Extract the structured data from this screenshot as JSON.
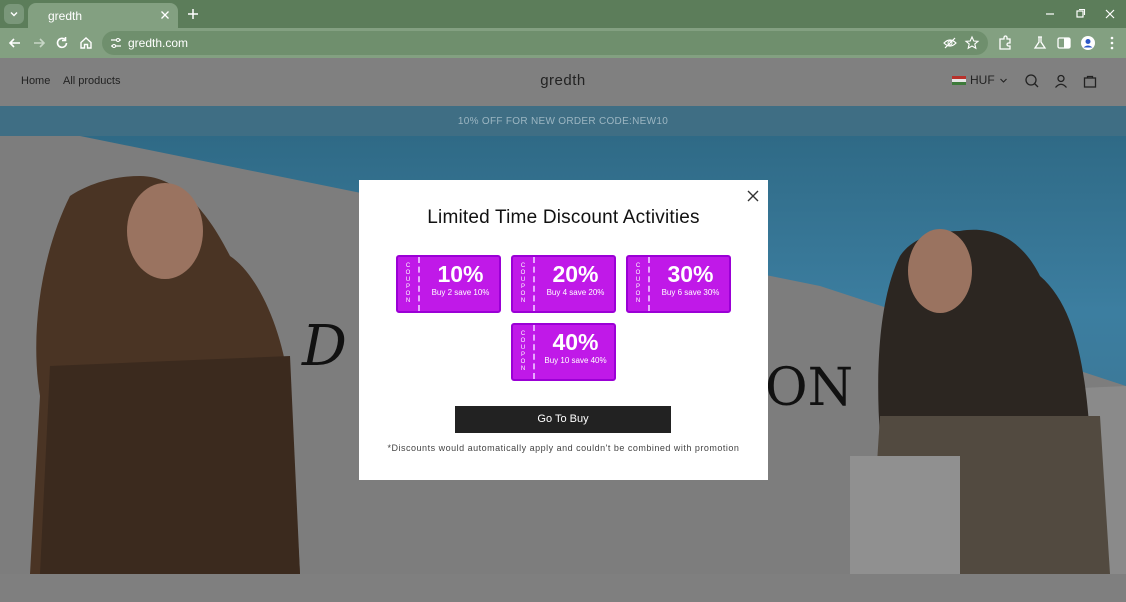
{
  "browser": {
    "tab_title": "gredth",
    "url": "gredth.com"
  },
  "site": {
    "nav": [
      "Home",
      "All products"
    ],
    "logo": "gredth",
    "currency": "HUF",
    "announcement": "10% OFF FOR NEW ORDER CODE:NEW10"
  },
  "hero": {
    "text_left": "D",
    "text_right": "ON"
  },
  "modal": {
    "title": "Limited Time Discount Activities",
    "coupons": [
      {
        "side": "COUPON",
        "percent": "10%",
        "desc": "Buy 2 save 10%"
      },
      {
        "side": "COUPON",
        "percent": "20%",
        "desc": "Buy 4 save 20%"
      },
      {
        "side": "COUPON",
        "percent": "30%",
        "desc": "Buy 6 save 30%"
      },
      {
        "side": "COUPON",
        "percent": "40%",
        "desc": "Buy 10 save 40%"
      }
    ],
    "button": "Go To Buy",
    "disclaimer": "*Discounts would automatically apply and couldn't be combined with promotion"
  },
  "colors": {
    "browser_frame": "#5c7d5a",
    "coupon_fill": "#c019e8",
    "button": "#222222"
  }
}
